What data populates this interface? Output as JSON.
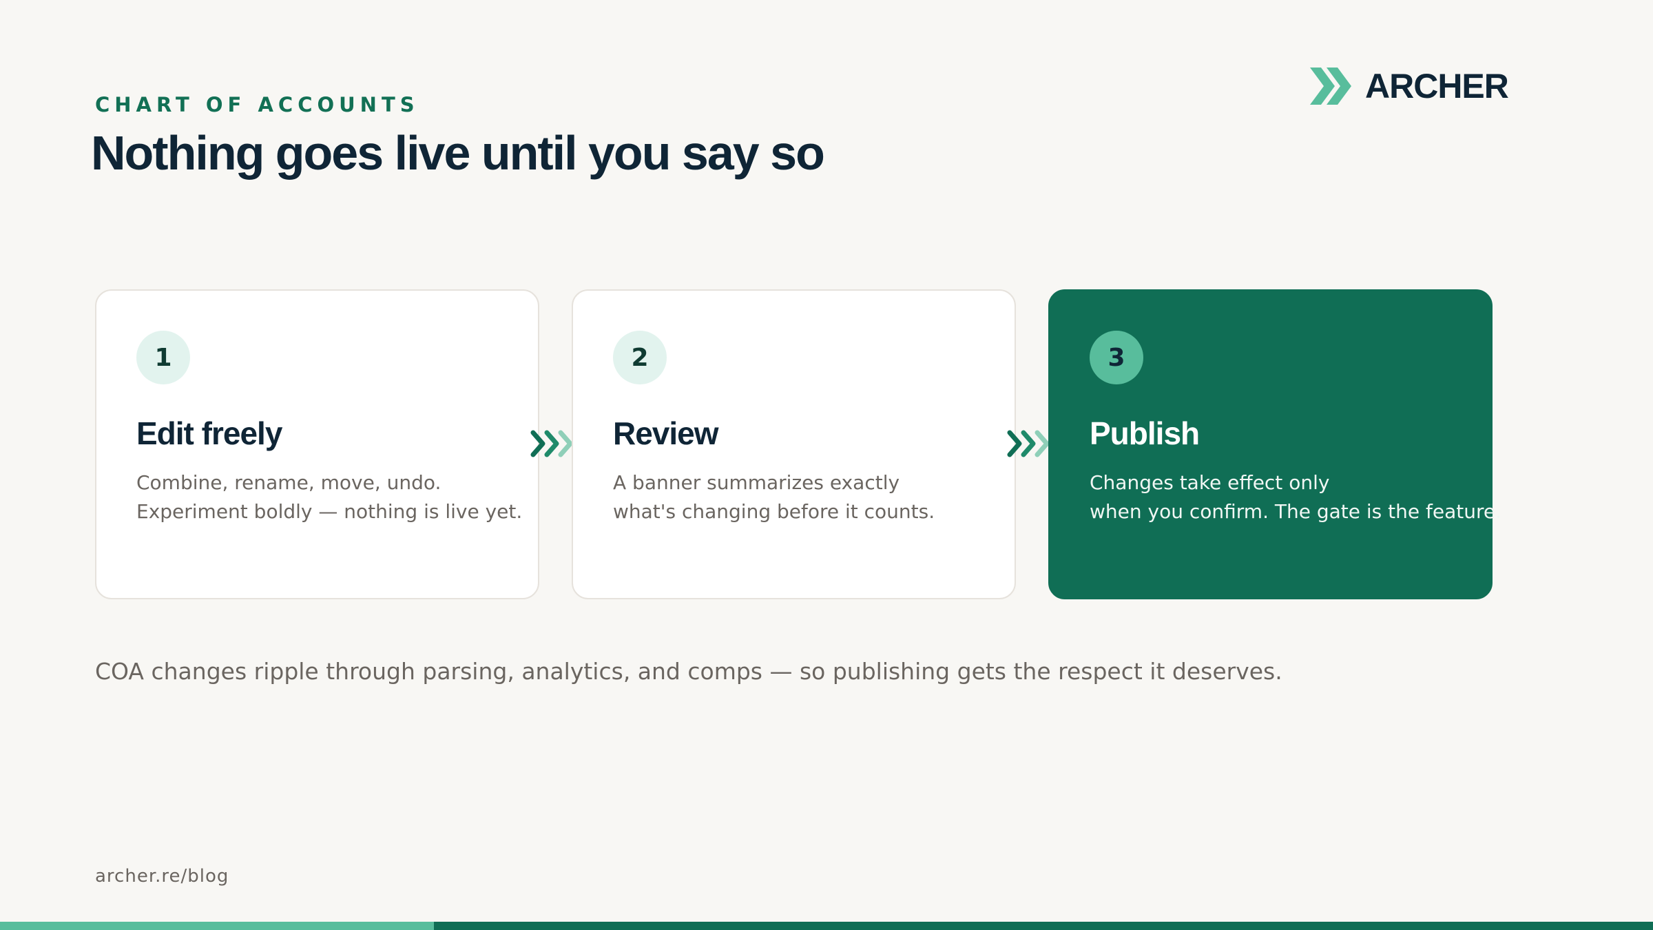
{
  "header": {
    "eyebrow": "CHART OF ACCOUNTS",
    "title": "Nothing goes live until you say so"
  },
  "brand": {
    "name": "ARCHER",
    "logo_icon": "double-chevron-icon",
    "accent_color": "#58bd9c",
    "primary_color": "#106e55",
    "text_color": "#0f2536"
  },
  "steps": [
    {
      "number": "1",
      "title": "Edit freely",
      "lines": [
        "Combine, rename, move, undo.",
        "Experiment boldly — nothing is live yet."
      ]
    },
    {
      "number": "2",
      "title": "Review",
      "lines": [
        "A banner summarizes exactly",
        "what's changing before it counts."
      ]
    },
    {
      "number": "3",
      "title": "Publish",
      "lines": [
        "Changes take effect only",
        "when you confirm. The gate is the feature."
      ],
      "highlighted": true
    }
  ],
  "step_connector_icon": "triple-chevron-right-icon",
  "footnote": "COA changes ripple through parsing, analytics, and comps — so publishing gets the respect it deserves.",
  "footer": {
    "url": "archer.re/blog"
  }
}
